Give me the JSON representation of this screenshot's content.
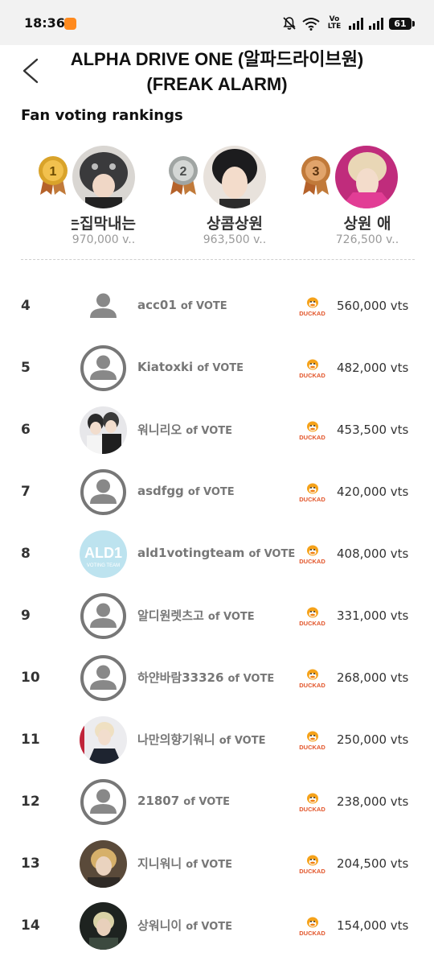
{
  "status": {
    "time": "18:36",
    "network": "Vo LTE",
    "battery": "61",
    "icons": [
      "app-notification-icon",
      "mute-bell-icon",
      "wifi-icon",
      "volte-icon",
      "signal-icon",
      "signal-icon",
      "battery-icon"
    ]
  },
  "header": {
    "back_icon": "chevron-left-icon",
    "title": "ALPHA DRIVE ONE (알파드라이브원)(FREAK ALARM)"
  },
  "section": {
    "title": "Fan voting rankings"
  },
  "colors": {
    "gold": "#d9a32a",
    "silver": "#a0a5a3",
    "bronze": "#c17a3a",
    "ribbon": "#b5622a",
    "muted_text": "#9a9a9a",
    "name_text": "#777777",
    "duck_orange": "#f5a21a"
  },
  "top3": [
    {
      "rank": "1",
      "name": "최애는집막내는",
      "votes": "970,000 v..",
      "medal": "gold-medal-icon"
    },
    {
      "rank": "2",
      "name": "상콤상원",
      "votes": "963,500 v..",
      "medal": "silver-medal-icon"
    },
    {
      "rank": "3",
      "name": "상원   애",
      "votes": "726,500 v..",
      "medal": "bronze-medal-icon"
    }
  ],
  "of_label": "of VOTE",
  "rows": [
    {
      "rank": "4",
      "name": "acc01",
      "votes": "560,000 vts",
      "avatar": "default"
    },
    {
      "rank": "5",
      "name": "Kiatoxki",
      "votes": "482,000 vts",
      "avatar": "default"
    },
    {
      "rank": "6",
      "name": "워니리오",
      "votes": "453,500 vts",
      "avatar": "photo"
    },
    {
      "rank": "7",
      "name": "asdfgg",
      "votes": "420,000 vts",
      "avatar": "default"
    },
    {
      "rank": "8",
      "name": "ald1votingteam",
      "votes": "408,000 vts",
      "avatar": "logo"
    },
    {
      "rank": "9",
      "name": "알디원렛츠고",
      "votes": "331,000 vts",
      "avatar": "default"
    },
    {
      "rank": "10",
      "name": "하얀바람33326",
      "votes": "268,000 vts",
      "avatar": "default"
    },
    {
      "rank": "11",
      "name": "나만의향기워니",
      "votes": "250,000 vts",
      "avatar": "photo"
    },
    {
      "rank": "12",
      "name": "21807",
      "votes": "238,000 vts",
      "avatar": "default"
    },
    {
      "rank": "13",
      "name": "지니워니",
      "votes": "204,500 vts",
      "avatar": "photo"
    },
    {
      "rank": "14",
      "name": "상워니이",
      "votes": "154,000 vts",
      "avatar": "photo"
    }
  ],
  "avatar_logo_text": "ALD1",
  "avatar_logo_sub": "VOTING TEAM",
  "duck_logo_text": "DUCKAD"
}
